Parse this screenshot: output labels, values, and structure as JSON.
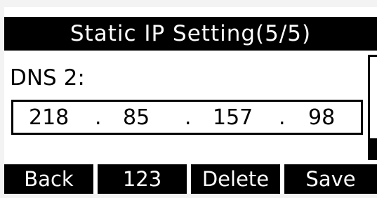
{
  "screen": {
    "title": "Static IP Setting(5/5)",
    "field_label": "DNS 2:",
    "ip": {
      "octet1": "218",
      "octet2": "85",
      "octet3": "157",
      "octet4": "98",
      "separator": "."
    }
  },
  "softkeys": {
    "back": "Back",
    "input_mode": "123",
    "delete": "Delete",
    "save": "Save"
  },
  "colors": {
    "background": "#ffffff",
    "inverse": "#000000"
  }
}
